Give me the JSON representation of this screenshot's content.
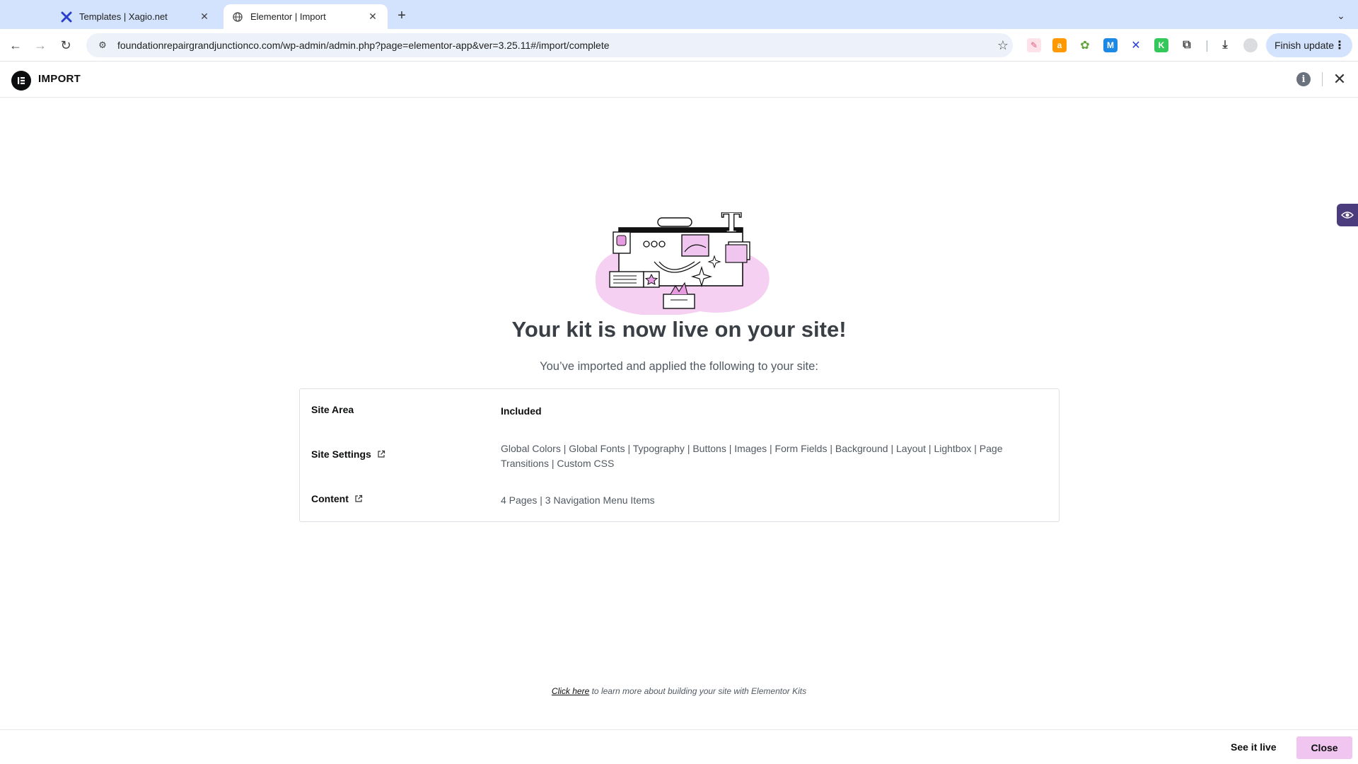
{
  "browser": {
    "tabs": [
      {
        "title": "Templates | Xagio.net",
        "active": false,
        "icon": "xagio-icon"
      },
      {
        "title": "Elementor | Import",
        "active": true,
        "icon": "globe-icon"
      }
    ],
    "url": "foundationrepairgrandjunctionco.com/wp-admin/admin.php?page=elementor-app&ver=3.25.11#/import/complete",
    "finish_update_label": "Finish update",
    "extensions": [
      {
        "name": "kit-extension-icon",
        "color": "#f6c9d3"
      },
      {
        "name": "amazon-icon",
        "color": "#ff9900"
      },
      {
        "name": "puzzle-flower-icon",
        "color": "#64a33c"
      },
      {
        "name": "mailchimp-icon",
        "color": "#1e88e5"
      },
      {
        "name": "xagio-icon",
        "color": "#2b3fcf"
      },
      {
        "name": "k-extension-icon",
        "color": "#34c759"
      },
      {
        "name": "extensions-puzzle-icon",
        "color": "#444444"
      }
    ]
  },
  "app": {
    "title": "IMPORT"
  },
  "main": {
    "heading": "Your kit is now live on your site!",
    "subtext": "You’ve imported and applied the following to your site:",
    "table": {
      "header": {
        "area": "Site Area",
        "included": "Included"
      },
      "rows": [
        {
          "area": "Site Settings",
          "included": "Global Colors | Global Fonts | Typography | Buttons | Images | Form Fields | Background | Layout | Lightbox | Page Transitions | Custom CSS"
        },
        {
          "area": "Content",
          "included": "4 Pages | 3 Navigation Menu Items"
        }
      ]
    },
    "learn_link": "Click here",
    "learn_text": " to learn more about building your site with Elementor Kits"
  },
  "footer": {
    "see_live_label": "See it live",
    "close_label": "Close"
  },
  "colors": {
    "accent_pink": "#f0c6f0",
    "tabstrip": "#d3e3fd",
    "side_widget": "#4b3d7d"
  }
}
